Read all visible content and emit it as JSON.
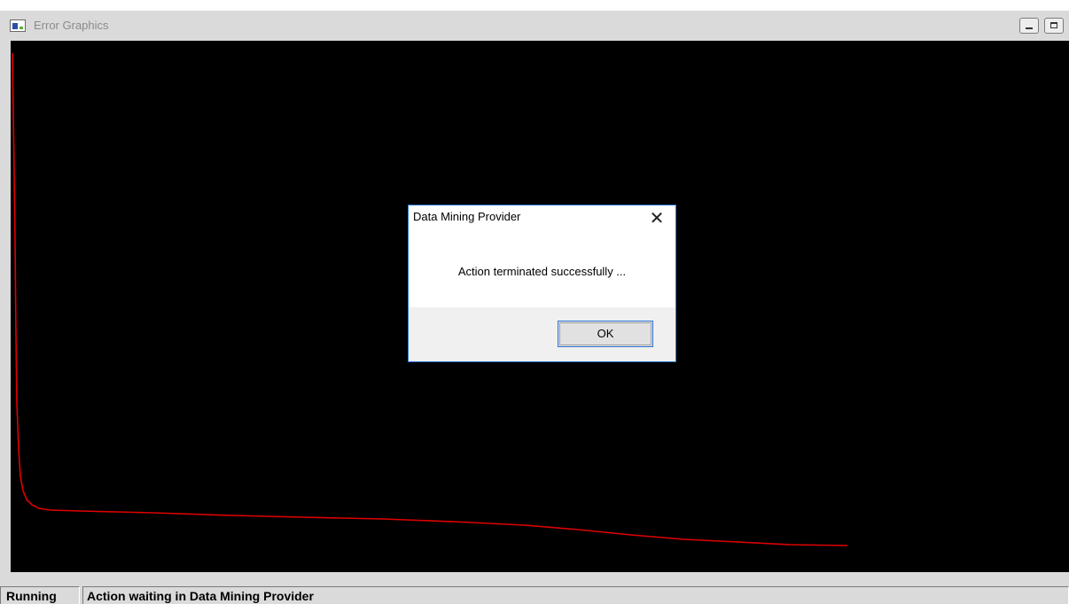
{
  "window": {
    "title": "Error Graphics",
    "minimize_icon": "minimize-icon",
    "maximize_icon": "maximize-icon",
    "app_icon": "app-icon"
  },
  "plot": {
    "background": "#000000",
    "line_color": "#e00000"
  },
  "statusbar": {
    "state": "Running",
    "message": "Action waiting in Data Mining Provider"
  },
  "dialog": {
    "title": "Data Mining Provider",
    "message": "Action terminated successfully ...",
    "ok_label": "OK",
    "close_icon": "close-icon",
    "accent": "#2d7ad6"
  }
}
